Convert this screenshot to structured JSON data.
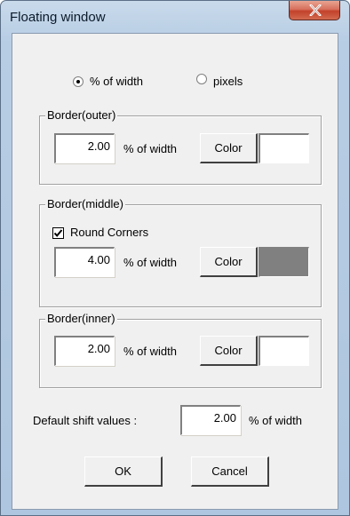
{
  "window": {
    "title": "Floating window",
    "close_icon": "close-x-icon"
  },
  "units": {
    "options": [
      {
        "label": "% of width",
        "selected": true
      },
      {
        "label": "pixels",
        "selected": false
      }
    ]
  },
  "border_outer": {
    "label": "Border(outer)",
    "value": "2.00",
    "unit": "% of width",
    "color_button": "Color",
    "color": "#ffffff"
  },
  "border_middle": {
    "label": "Border(middle)",
    "round_corners_label": "Round Corners",
    "round_corners_checked": true,
    "value": "4.00",
    "unit": "% of width",
    "color_button": "Color",
    "color": "#808080"
  },
  "border_inner": {
    "label": "Border(inner)",
    "value": "2.00",
    "unit": "% of width",
    "color_button": "Color",
    "color": "#ffffff"
  },
  "shift": {
    "label": "Default shift values :",
    "value": "2.00",
    "unit": "% of width"
  },
  "buttons": {
    "ok": "OK",
    "cancel": "Cancel"
  }
}
